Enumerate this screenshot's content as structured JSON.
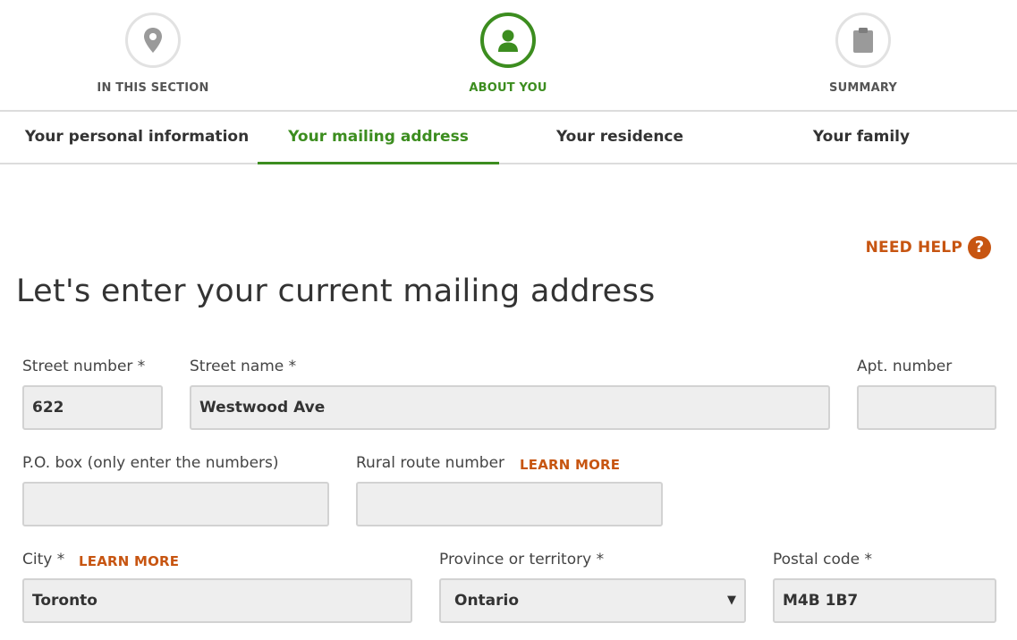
{
  "stepper": {
    "steps": [
      {
        "label": "IN THIS SECTION",
        "icon": "map-pin-icon",
        "state": "inactive"
      },
      {
        "label": "ABOUT YOU",
        "icon": "person-icon",
        "state": "active"
      },
      {
        "label": "SUMMARY",
        "icon": "clipboard-icon",
        "state": "inactive"
      }
    ]
  },
  "tabs": [
    {
      "label": "Your personal information",
      "active": false
    },
    {
      "label": "Your mailing address",
      "active": true
    },
    {
      "label": "Your residence",
      "active": false
    },
    {
      "label": "Your family",
      "active": false
    }
  ],
  "help": {
    "label": "NEED HELP",
    "icon_glyph": "?"
  },
  "page": {
    "title": "Let's enter your current mailing address"
  },
  "form": {
    "street_number": {
      "label": "Street number *",
      "value": "622"
    },
    "street_name": {
      "label": "Street name *",
      "value": "Westwood Ave"
    },
    "apt_number": {
      "label": "Apt. number",
      "value": ""
    },
    "po_box": {
      "label": "P.O. box (only enter the numbers)",
      "value": ""
    },
    "rural_route": {
      "label": "Rural route number",
      "learn_more": "LEARN MORE",
      "value": ""
    },
    "city": {
      "label": "City *",
      "learn_more": "LEARN MORE",
      "value": "Toronto"
    },
    "province": {
      "label": "Province or territory *",
      "value": "Ontario",
      "arrow": "▼"
    },
    "postal_code": {
      "label": "Postal code *",
      "value": "M4B 1B7"
    }
  },
  "colors": {
    "active_green": "#3c8d1f",
    "accent_orange": "#c75511",
    "input_bg": "#eeeeee"
  }
}
